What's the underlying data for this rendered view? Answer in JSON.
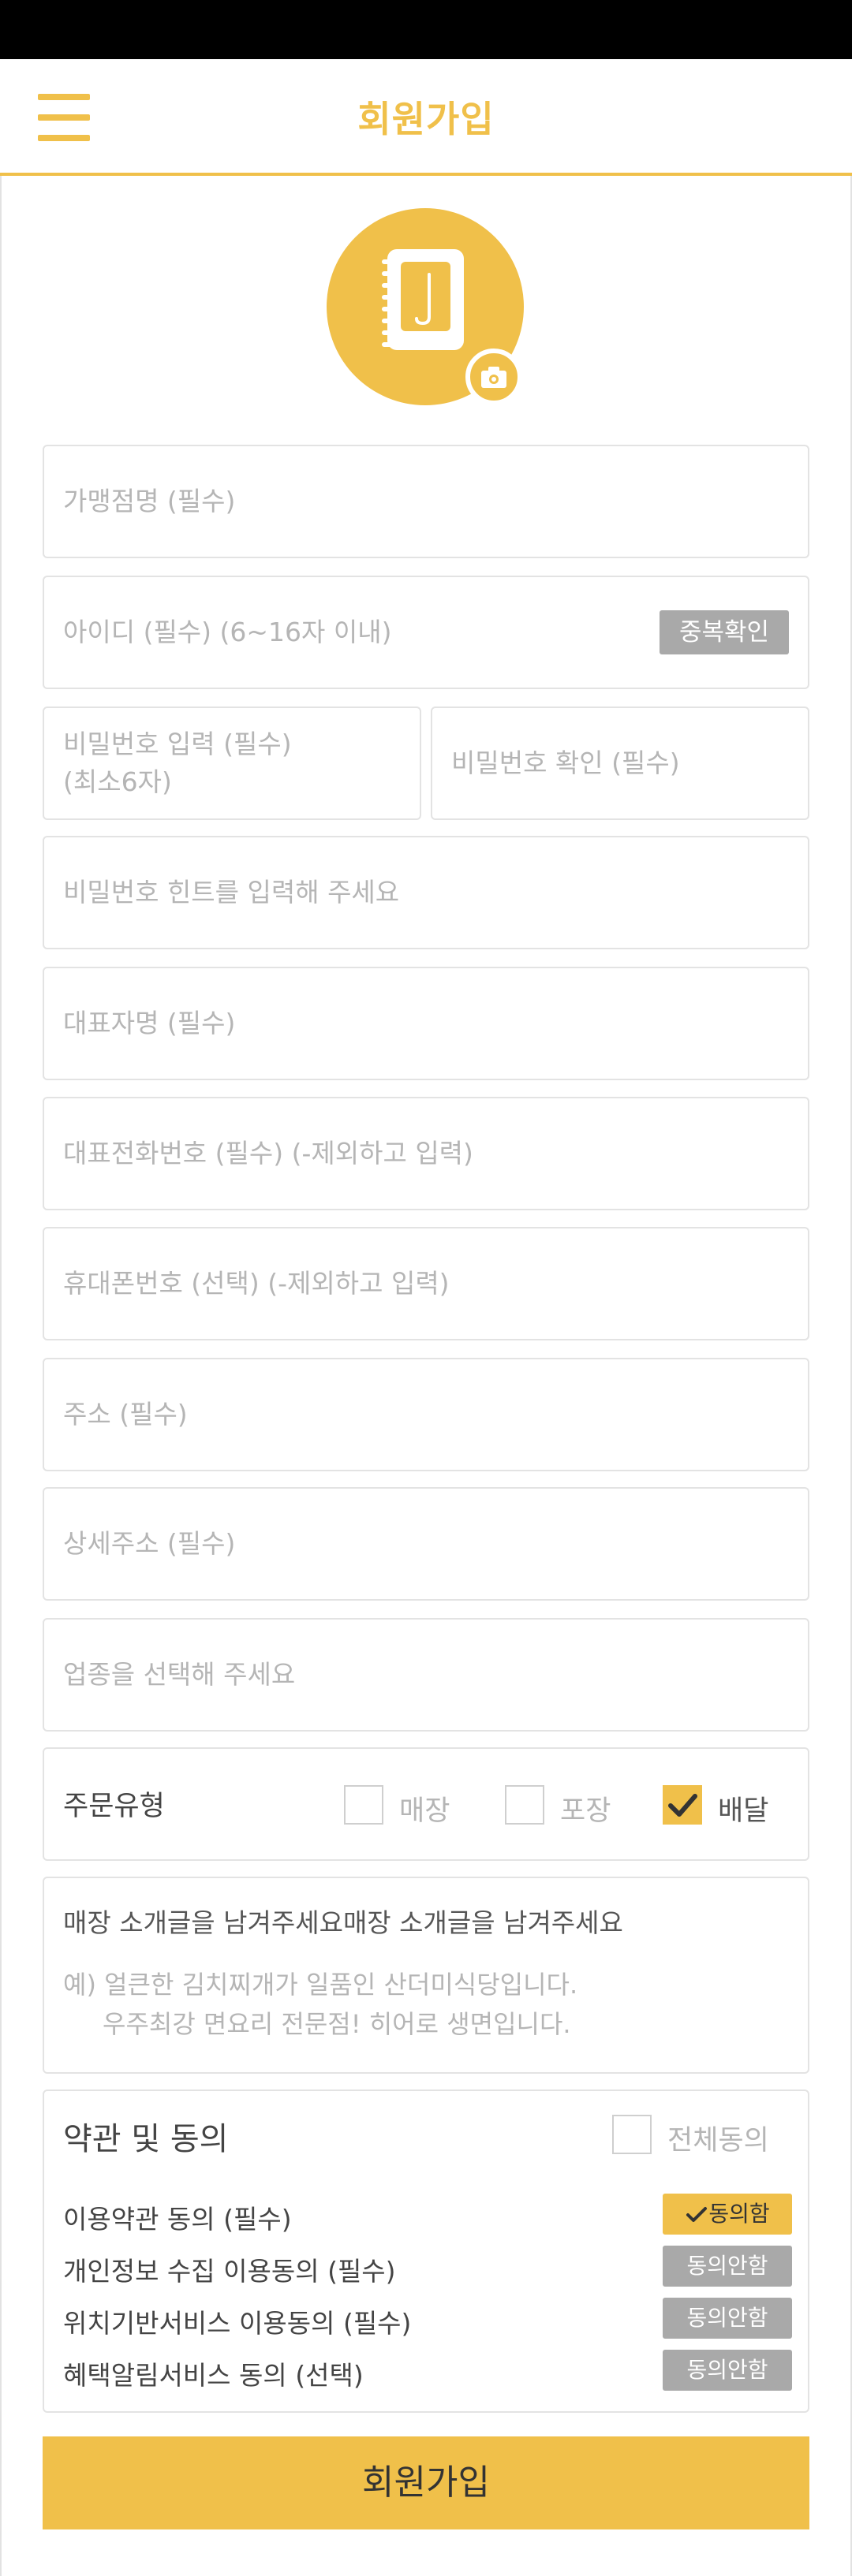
{
  "header": {
    "title": "회원가입"
  },
  "form": {
    "store_name": "가맹점명 (필수)",
    "user_id": "아이디 (필수) (6~16자 이내)",
    "duplicate_check": "중복확인",
    "password": "비밀번호 입력 (필수)",
    "password_note": "(최소6자)",
    "password_confirm": "비밀번호 확인 (필수)",
    "password_hint": "비밀번호 힌트를 입력해 주세요",
    "representative": "대표자명 (필수)",
    "phone": "대표전화번호 (필수) (-제외하고 입력)",
    "mobile": "휴대폰번호 (선택) (-제외하고 입력)",
    "address": "주소 (필수)",
    "address_detail": "상세주소 (필수)",
    "business_type": "업종을 선택해 주세요"
  },
  "order_type": {
    "label": "주문유형",
    "options": [
      {
        "label": "매장",
        "checked": false
      },
      {
        "label": "포장",
        "checked": false
      },
      {
        "label": "배달",
        "checked": true
      }
    ]
  },
  "intro": {
    "title": "매장 소개글을 남겨주세요매장 소개글을 남겨주세요",
    "example_line1": "예) 얼큰한 김치찌개가 일품인 산더미식당입니다.",
    "example_line2": "우주최강 면요리 전문점! 히어로 생면입니다."
  },
  "terms": {
    "title": "약관 및 동의",
    "all_agree": "전체동의",
    "items": [
      {
        "label": "이용약관 동의 (필수)",
        "status": "동의함",
        "agreed": true
      },
      {
        "label": "개인정보 수집 이용동의 (필수)",
        "status": "동의안함",
        "agreed": false
      },
      {
        "label": "위치기반서비스 이용동의 (필수)",
        "status": "동의안함",
        "agreed": false
      },
      {
        "label": "혜택알림서비스 동의 (선택)",
        "status": "동의안함",
        "agreed": false
      }
    ]
  },
  "submit_label": "회원가입",
  "colors": {
    "accent": "#f0c04a",
    "button_gray": "#a9a9a9",
    "placeholder": "#b5b5b5"
  }
}
